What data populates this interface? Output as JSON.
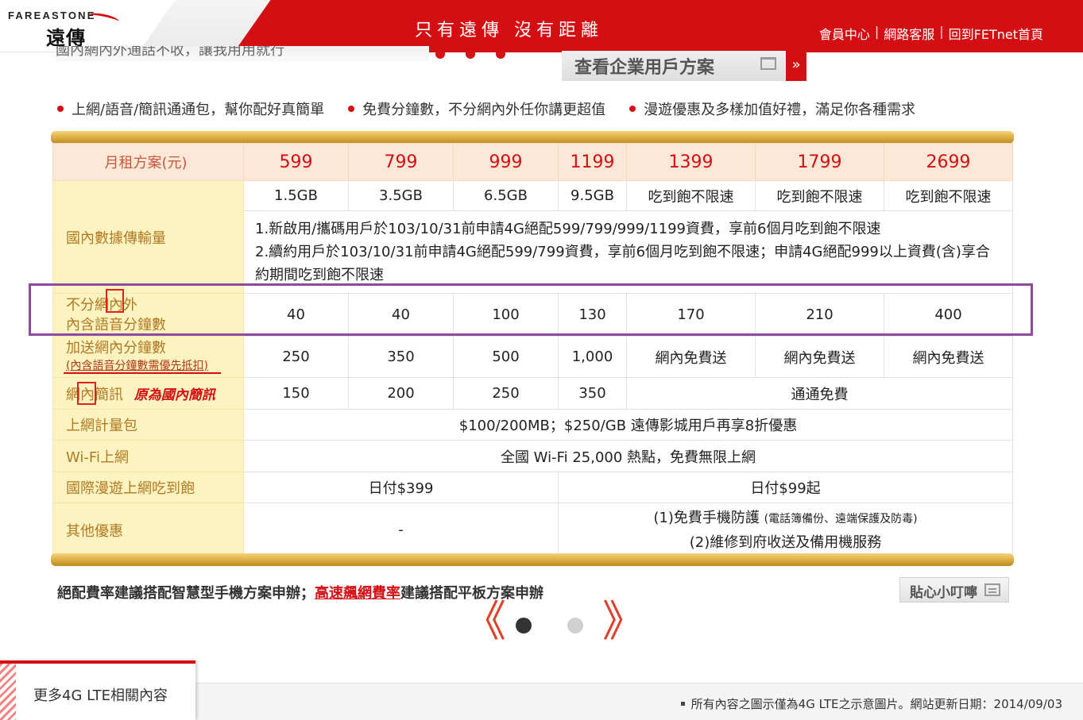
{
  "header": {
    "logo_en": "FAREASTONE",
    "logo_zh": "遠傳",
    "slogan": "只有遠傳 沒有距離",
    "links": [
      "會員中心",
      "網路客服",
      "回到FETnet首頁"
    ],
    "separator": "|"
  },
  "hidden_strip": {
    "text": "國內網內外通話不收，讓我用用就行"
  },
  "enterprise_button": {
    "label": "查看企業用戶方案",
    "arrow": "»"
  },
  "features": [
    "上網/語音/簡訊通通包，幫你配好真簡單",
    "免費分鐘數，不分網內外任你講更超值",
    "漫遊優惠及多樣加值好禮，滿足你各種需求"
  ],
  "table": {
    "price_header": "月租方案(元)",
    "prices": [
      "599",
      "799",
      "999",
      "1199",
      "1399",
      "1799",
      "2699"
    ],
    "data_label": "國內數據傳輸量",
    "data_values": [
      "1.5GB",
      "3.5GB",
      "6.5GB",
      "9.5GB",
      "吃到飽不限速",
      "吃到飽不限速",
      "吃到飽不限速"
    ],
    "data_note_1": "1.新啟用/攜碼用戶於103/10/31前申請4G絕配599/799/999/1199資費，享前6個月吃到飽不限速",
    "data_note_2": "2.續約用戶於103/10/31前申請4G絕配599/799資費，享前6個月吃到飽不限速；申請4G絕配999以上資費(含)享合約期間吃到飽不限速",
    "voice_label_1": "不分網內外",
    "voice_label_2": "內含語音分鐘數",
    "voice_values": [
      "40",
      "40",
      "100",
      "130",
      "170",
      "210",
      "400"
    ],
    "onnet_label": "加送網內分鐘數",
    "onnet_sub": "(內含語音分鐘數需優先抵扣)",
    "onnet_values": [
      "250",
      "350",
      "500",
      "1,000",
      "網內免費送",
      "網內免費送",
      "網內免費送"
    ],
    "sms_label": "網內簡訊",
    "sms_orig_note": "原為國內簡訊",
    "sms_values": [
      "150",
      "200",
      "250",
      "350"
    ],
    "sms_free": "通通免費",
    "metered_label": "上網計量包",
    "metered_value": "$100/200MB；$250/GB 遠傳影城用戶再享8折優惠",
    "wifi_label": "Wi-Fi上網",
    "wifi_value": "全國 Wi-Fi 25,000 熱點，免費無限上網",
    "roaming_label": "國際漫遊上網吃到飽",
    "roaming_low": "日付$399",
    "roaming_high": "日付$99起",
    "other_label": "其他優惠",
    "other_low": "-",
    "other_high_1_main": "(1)免費手機防護",
    "other_high_1_small": "(電話簿備份、遠端保護及防毒)",
    "other_high_2": "(2)維修到府收送及備用機服務"
  },
  "rate_note": {
    "part1": "絕配費率建議搭配智慧型手機方案申辦；",
    "link": "高速飆網費率",
    "part2": "建議搭配平板方案申辦"
  },
  "tip_button": {
    "label": "貼心小叮嚀"
  },
  "carousel": {
    "prev": "《",
    "next": "》"
  },
  "footer": {
    "more_tab": "更多4G LTE相關內容",
    "note": "所有內容之圖示僅為4G LTE之示意圖片。網站更新日期：2014/09/03"
  },
  "colors": {
    "brand_red": "#d40f14",
    "row_head_bg": "#fcf3c0",
    "price_row_bg": "#fde7d6",
    "highlight_purple": "#8d4aa0",
    "gold": "#d6a93a"
  }
}
